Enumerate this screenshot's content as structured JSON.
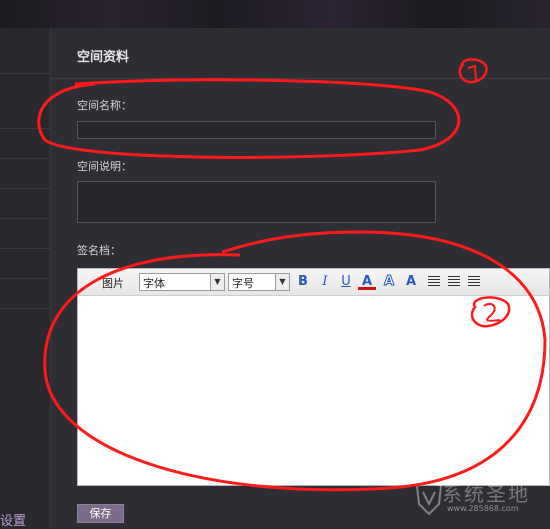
{
  "sidebar": {
    "settings_label": "设置"
  },
  "main": {
    "title": "空间资料",
    "space_name": {
      "label": "空间名称：",
      "value": ""
    },
    "space_desc": {
      "label": "空间说明：",
      "value": ""
    },
    "signature": {
      "label": "签名档："
    }
  },
  "editor": {
    "toolbar": {
      "picture_label": "图片",
      "font_select": "字体",
      "size_select": "字号",
      "bold": "B",
      "italic": "I",
      "underline": "U",
      "font_color": "A",
      "highlight": "A",
      "clear_format": "A"
    }
  },
  "save_label": "保存",
  "annotations": {
    "one": "1",
    "two": "2",
    "color": "#ff1a1a"
  },
  "watermark": {
    "text": "系统圣地",
    "url": "www.285868.com"
  }
}
